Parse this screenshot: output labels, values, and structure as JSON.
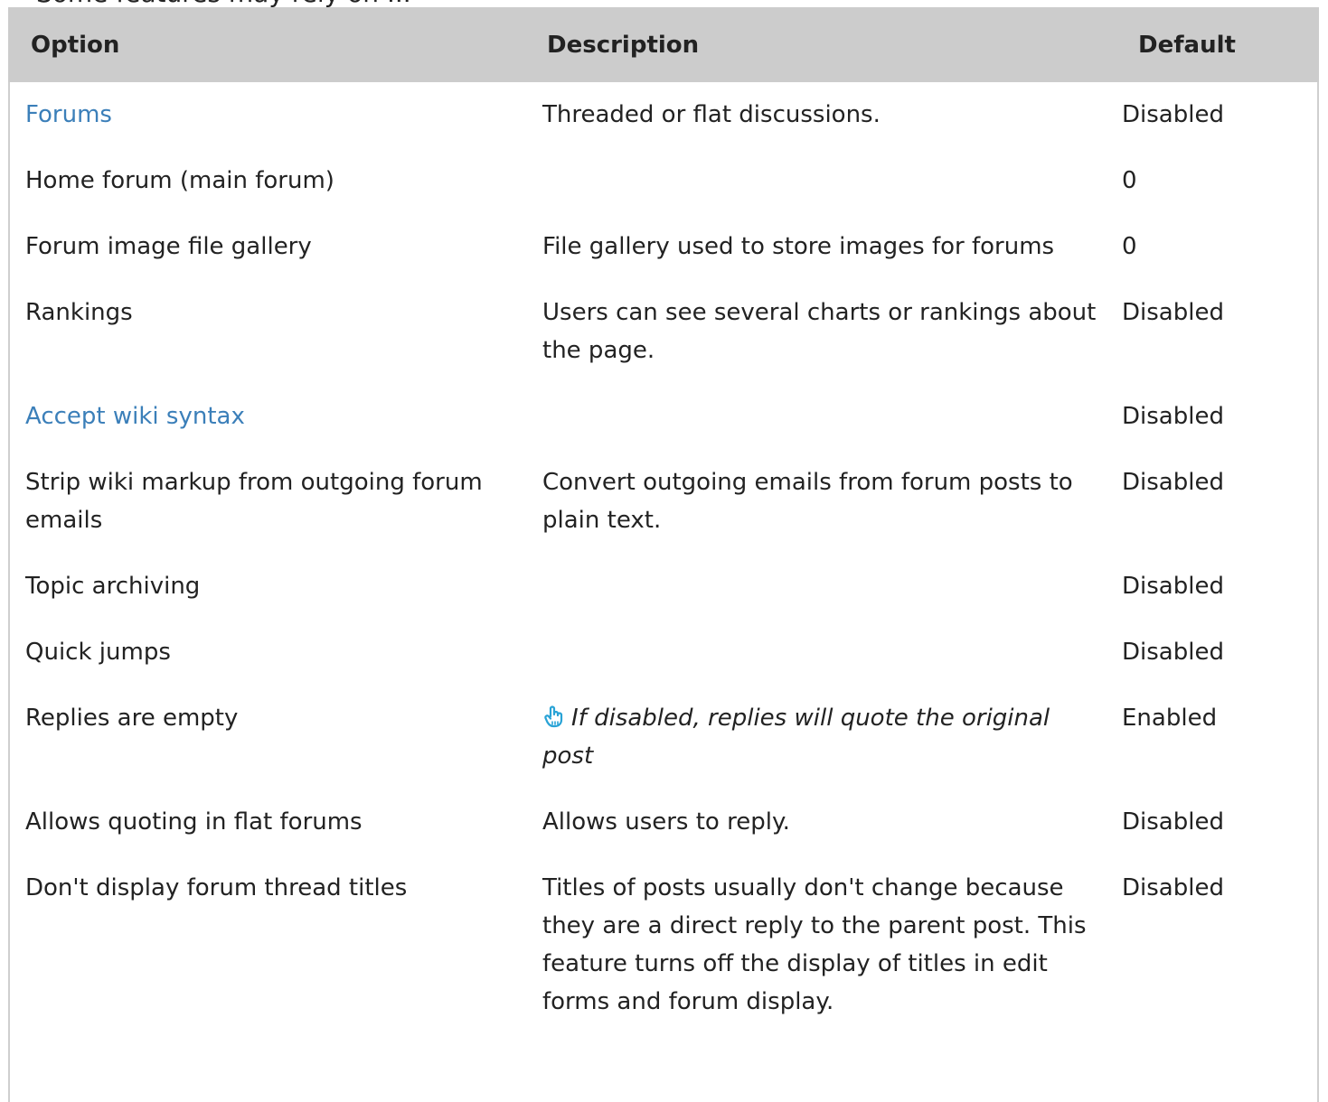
{
  "header": {
    "top_cut_text": "Some features may rely on ..."
  },
  "table": {
    "columns": [
      "Option",
      "Description",
      "Default"
    ],
    "rows": [
      {
        "option": "Forums",
        "option_is_link": true,
        "description": "Threaded or flat discussions.",
        "default": "Disabled"
      },
      {
        "option": "Home forum (main forum)",
        "option_is_link": false,
        "description": "",
        "default": "0"
      },
      {
        "option": "Forum image file gallery",
        "option_is_link": false,
        "description": "File gallery used to store images for forums",
        "default": "0"
      },
      {
        "option": "Rankings",
        "option_is_link": false,
        "description": "Users can see several charts or rankings about the page.",
        "default": "Disabled"
      },
      {
        "option": "Accept wiki syntax",
        "option_is_link": true,
        "description": "",
        "default": "Disabled"
      },
      {
        "option": "Strip wiki markup from outgoing forum emails",
        "option_is_link": false,
        "description": "Convert outgoing emails from forum posts to plain text.",
        "default": "Disabled"
      },
      {
        "option": "Topic archiving",
        "option_is_link": false,
        "description": "",
        "default": "Disabled"
      },
      {
        "option": "Quick jumps",
        "option_is_link": false,
        "description": "",
        "default": "Disabled"
      },
      {
        "option": "Replies are empty",
        "option_is_link": false,
        "description": "If disabled, replies will quote the original post",
        "description_icon": "pointing-hand-icon",
        "default": "Enabled"
      },
      {
        "option": "Allows quoting in flat forums",
        "option_is_link": false,
        "description": "Allows users to reply.",
        "default": "Disabled"
      },
      {
        "option": "Don't display forum thread titles",
        "option_is_link": false,
        "description": "Titles of posts usually don't change because they are a direct reply to the parent post. This feature turns off the display of titles in edit forms and forum display.",
        "default": "Disabled"
      }
    ]
  },
  "colors": {
    "header_bg": "#cccccc",
    "link": "#3b7fb9",
    "icon": "#29a3d6"
  }
}
